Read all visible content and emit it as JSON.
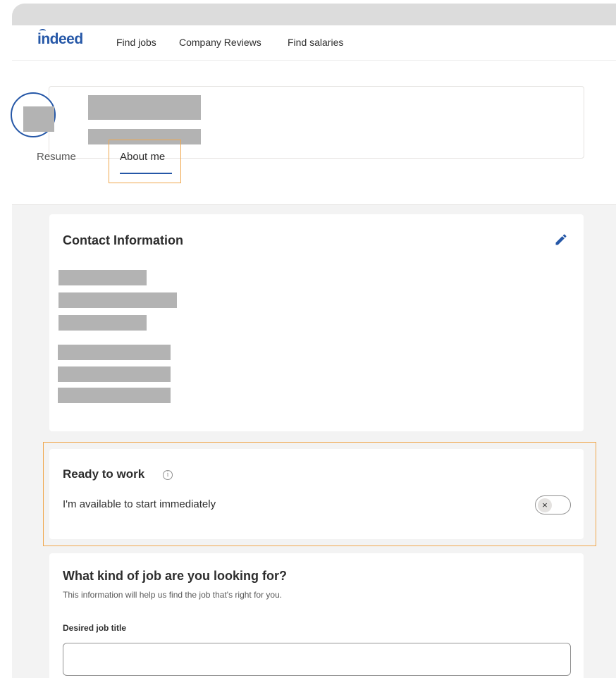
{
  "navbar": {
    "logo_text": "indeed",
    "links": [
      "Find jobs",
      "Company Reviews",
      "Find salaries"
    ]
  },
  "profile": {
    "tabs": [
      "Resume",
      "About me"
    ],
    "active_tab": "About me"
  },
  "contact_card": {
    "title": "Contact Information",
    "edit_icon": "pencil-icon"
  },
  "ready_card": {
    "title": "Ready to work",
    "info_icon": "info-icon",
    "info_glyph": "i",
    "description": "I'm available to start immediately",
    "toggle_on": false,
    "toggle_glyph": "×"
  },
  "job_card": {
    "title": "What kind of job are you looking for?",
    "subtitle": "This information will help us find the job that's right for you.",
    "desired_title_label": "Desired job title",
    "desired_title_value": ""
  },
  "colors": {
    "brand_blue": "#2557a7",
    "highlight_orange": "#f0a74d",
    "redaction_gray": "#b3b3b3"
  }
}
